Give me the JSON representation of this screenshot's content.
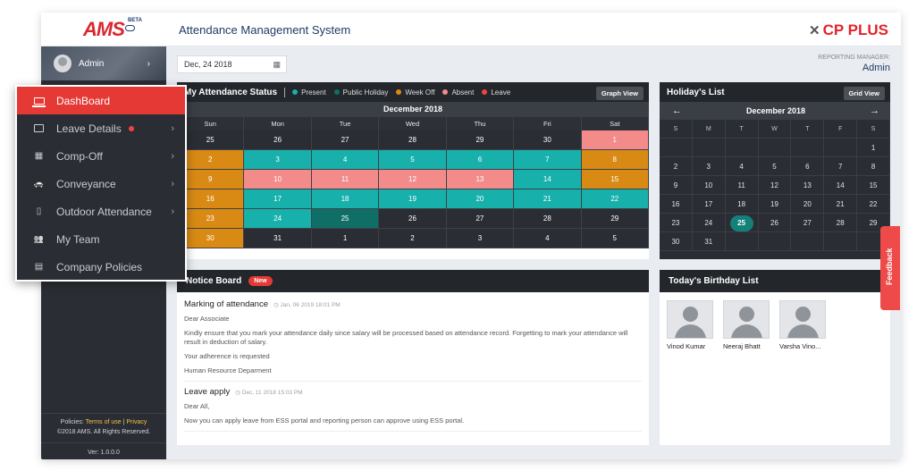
{
  "app": {
    "logo_text": "AMS",
    "logo_badge": "BETA",
    "title": "Attendance Management System",
    "brand": "CP PLUS"
  },
  "profile": {
    "name": "Admin"
  },
  "menu": {
    "items": [
      {
        "label": "DashBoard",
        "icon": "laptop-icon",
        "active": true
      },
      {
        "label": "Leave Details",
        "icon": "calendar-icon",
        "dot": true,
        "chevron": true
      },
      {
        "label": "Comp-Off",
        "icon": "calendar-grid-icon",
        "chevron": true
      },
      {
        "label": "Conveyance",
        "icon": "car-icon",
        "chevron": true
      },
      {
        "label": "Outdoor Attendance",
        "icon": "mobile-icon",
        "chevron": true
      },
      {
        "label": "My Team",
        "icon": "users-icon"
      },
      {
        "label": "Company Policies",
        "icon": "document-icon"
      }
    ]
  },
  "footer": {
    "policies": "Policies:",
    "terms": "Terms of use",
    "sep": "|",
    "privacy": "Privacy",
    "copyright": "©2018 AMS. All Rights Reserved.",
    "version": "Ver: 1.0.0.0"
  },
  "datebar": {
    "date": "Dec, 24 2018",
    "reporting_label": "REPORTING MANAGER:",
    "reporting_name": "Admin"
  },
  "attendance": {
    "title": "My Attendance Status",
    "legend": [
      {
        "label": "Present",
        "color": "#17b0aa"
      },
      {
        "label": "Public Holiday",
        "color": "#0f6f66"
      },
      {
        "label": "Week Off",
        "color": "#d98a14"
      },
      {
        "label": "Absent",
        "color": "#f48b8b"
      },
      {
        "label": "Leave",
        "color": "#ef4444"
      }
    ],
    "button": "Graph View",
    "month": "December 2018",
    "dow": [
      "Sun",
      "Mon",
      "Tue",
      "Wed",
      "Thu",
      "Fri",
      "Sat"
    ],
    "rows": [
      [
        [
          "25",
          ""
        ],
        [
          "26",
          ""
        ],
        [
          "27",
          ""
        ],
        [
          "28",
          ""
        ],
        [
          "29",
          ""
        ],
        [
          "30",
          ""
        ],
        [
          "1",
          "absent"
        ]
      ],
      [
        [
          "2",
          "weekoff"
        ],
        [
          "3",
          "present"
        ],
        [
          "4",
          "present"
        ],
        [
          "5",
          "present"
        ],
        [
          "6",
          "present"
        ],
        [
          "7",
          "present"
        ],
        [
          "8",
          "weekoff"
        ]
      ],
      [
        [
          "9",
          "weekoff"
        ],
        [
          "10",
          "absent"
        ],
        [
          "11",
          "absent"
        ],
        [
          "12",
          "absent"
        ],
        [
          "13",
          "absent"
        ],
        [
          "14",
          "present"
        ],
        [
          "15",
          "weekoff"
        ]
      ],
      [
        [
          "16",
          "weekoff"
        ],
        [
          "17",
          "present"
        ],
        [
          "18",
          "present"
        ],
        [
          "19",
          "present"
        ],
        [
          "20",
          "present"
        ],
        [
          "21",
          "present"
        ],
        [
          "22",
          "present"
        ]
      ],
      [
        [
          "23",
          "weekoff"
        ],
        [
          "24",
          "present"
        ],
        [
          "25",
          "today"
        ],
        [
          "26",
          ""
        ],
        [
          "27",
          ""
        ],
        [
          "28",
          ""
        ],
        [
          "29",
          ""
        ]
      ],
      [
        [
          "30",
          "weekoff"
        ],
        [
          "31",
          ""
        ],
        [
          "1",
          ""
        ],
        [
          "2",
          ""
        ],
        [
          "3",
          ""
        ],
        [
          "4",
          ""
        ],
        [
          "5",
          ""
        ]
      ]
    ]
  },
  "holiday": {
    "title": "Holiday's List",
    "button": "Grid View",
    "month": "December 2018",
    "prev": "←",
    "next": "→",
    "dow": [
      "S",
      "M",
      "T",
      "W",
      "T",
      "F",
      "S"
    ],
    "rows": [
      [
        "",
        "",
        "",
        "",
        "",
        "",
        "1"
      ],
      [
        "2",
        "3",
        "4",
        "5",
        "6",
        "7",
        "8"
      ],
      [
        "9",
        "10",
        "11",
        "12",
        "13",
        "14",
        "15"
      ],
      [
        "16",
        "17",
        "18",
        "19",
        "20",
        "21",
        "22"
      ],
      [
        "23",
        "24",
        "25",
        "26",
        "27",
        "28",
        "29"
      ],
      [
        "30",
        "31",
        "",
        "",
        "",
        "",
        ""
      ]
    ],
    "highlight": "25"
  },
  "notice": {
    "title": "Notice Board",
    "badge": "New",
    "items": [
      {
        "title": "Marking of attendance",
        "date": "Jan, 06 2019 18:01 PM",
        "paragraphs": [
          "Dear Associate",
          "Kindly ensure that you mark your attendance daily since salary will be processed based on attendance record. Forgetting to mark your attendance will result in deduction of salary.",
          "Your adherence is requested",
          "Human Resource Deparment"
        ]
      },
      {
        "title": "Leave apply",
        "date": "Dec, 11 2018 15:03 PM",
        "paragraphs": [
          "Dear All,",
          "Now you can apply leave from ESS portal and reporting person can approve using ESS portal."
        ]
      }
    ]
  },
  "birthday": {
    "title": "Today's Birthday List",
    "people": [
      "Vinod Kumar",
      "Neeraj Bhatt",
      "Varsha Vino..."
    ]
  },
  "feedback": {
    "label": "Feedback"
  },
  "colors": {
    "accent": "#e53935",
    "dark": "#2a2d33",
    "present": "#17b0aa",
    "weekoff": "#d98a14",
    "absent": "#f48b8b"
  }
}
